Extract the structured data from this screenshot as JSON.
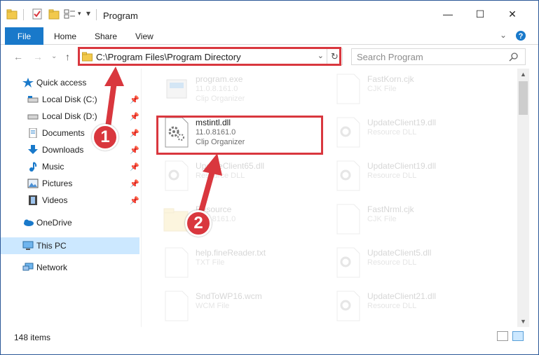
{
  "window": {
    "title": "Program",
    "controls": {
      "minimize": "—",
      "maximize": "☐",
      "close": "✕"
    }
  },
  "ribbon": {
    "file_tab": "File",
    "tabs": [
      "Home",
      "Share",
      "View"
    ]
  },
  "address_bar": {
    "path": "C:\\Program Files\\Program Directory",
    "search_placeholder": "Search Program"
  },
  "sidebar": {
    "items": [
      {
        "label": "Quick access",
        "icon": "star-icon"
      },
      {
        "label": "Local Disk (C:)",
        "icon": "drive-icon",
        "pinned": true
      },
      {
        "label": "Local Disk (D:)",
        "icon": "drive-icon",
        "pinned": true
      },
      {
        "label": "Documents",
        "icon": "documents-icon",
        "pinned": true
      },
      {
        "label": "Downloads",
        "icon": "downloads-icon",
        "pinned": true
      },
      {
        "label": "Music",
        "icon": "music-icon",
        "pinned": true
      },
      {
        "label": "Pictures",
        "icon": "pictures-icon",
        "pinned": true
      },
      {
        "label": "Videos",
        "icon": "videos-icon",
        "pinned": true
      },
      {
        "label": "OneDrive",
        "icon": "cloud-icon"
      },
      {
        "label": "This PC",
        "icon": "computer-icon",
        "selected": true
      },
      {
        "label": "Network",
        "icon": "network-icon"
      }
    ]
  },
  "files": {
    "left": [
      {
        "name": "program.exe",
        "line1": "11.0.8.161.0",
        "line2": "Clip Organizer"
      },
      {
        "name": "mstintl.dll",
        "line1": "11.0.8161.0",
        "line2": "Clip Organizer"
      },
      {
        "name": "UpdateClient65.dll",
        "line1": "Resource DLL",
        "line2": ""
      },
      {
        "name": "Resource",
        "line1": "11.0.8161.0",
        "line2": ""
      },
      {
        "name": "help.fineReader.txt",
        "line1": "TXT File",
        "line2": ""
      },
      {
        "name": "SndToWP16.wcm",
        "line1": "WCM File",
        "line2": ""
      }
    ],
    "right": [
      {
        "name": "FastKorn.cjk",
        "line1": "CJK File",
        "line2": ""
      },
      {
        "name": "UpdateClient19.dll",
        "line1": "Resource DLL",
        "line2": ""
      },
      {
        "name": "UpdateClient19.dll",
        "line1": "Resource DLL",
        "line2": ""
      },
      {
        "name": "FastNrml.cjk",
        "line1": "CJK File",
        "line2": ""
      },
      {
        "name": "UpdateClient5.dll",
        "line1": "Resource DLL",
        "line2": ""
      },
      {
        "name": "UpdateClient21.dll",
        "line1": "Resource DLL",
        "line2": ""
      }
    ]
  },
  "status": {
    "item_count": "148 items"
  },
  "annotations": {
    "step1": "1",
    "step2": "2",
    "color": "#d9373e"
  }
}
